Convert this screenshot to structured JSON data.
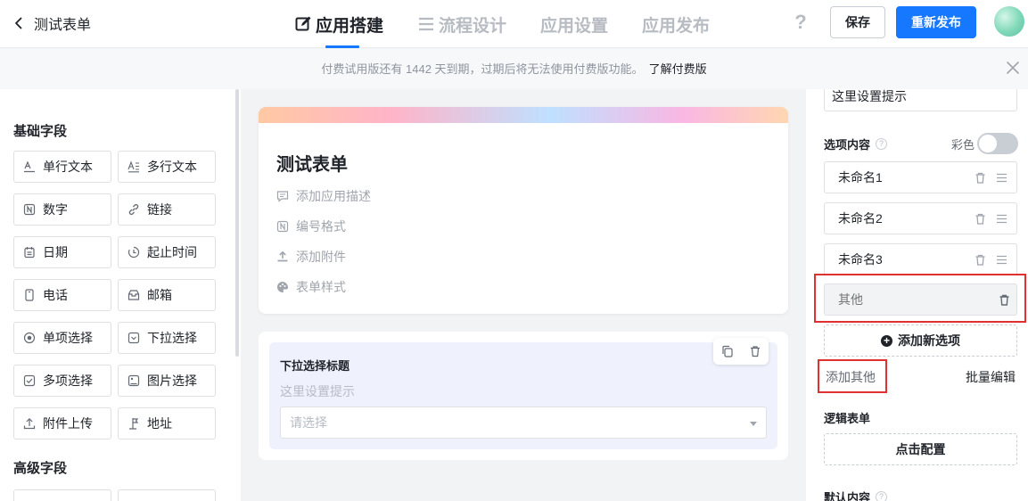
{
  "header": {
    "back_label": "测试表单",
    "tabs": [
      {
        "label": "应用搭建",
        "active": true
      },
      {
        "label": "流程设计",
        "active": false
      },
      {
        "label": "应用设置",
        "active": false
      },
      {
        "label": "应用发布",
        "active": false
      }
    ],
    "help_label": "?",
    "save_label": "保存",
    "publish_label": "重新发布",
    "accent_color": "#1677ff"
  },
  "banner": {
    "text": "付费试用版还有 1442 天到期，过期后将无法使用付费版功能。",
    "link": "了解付费版"
  },
  "left_panel": {
    "basic_title": "基础字段",
    "basic_fields": [
      {
        "label": "单行文本",
        "icon": "single-line-text-icon"
      },
      {
        "label": "多行文本",
        "icon": "multi-line-text-icon"
      },
      {
        "label": "数字",
        "icon": "number-icon"
      },
      {
        "label": "链接",
        "icon": "link-icon"
      },
      {
        "label": "日期",
        "icon": "calendar-icon"
      },
      {
        "label": "起止时间",
        "icon": "time-range-icon"
      },
      {
        "label": "电话",
        "icon": "phone-icon"
      },
      {
        "label": "邮箱",
        "icon": "mail-icon"
      },
      {
        "label": "单项选择",
        "icon": "radio-icon"
      },
      {
        "label": "下拉选择",
        "icon": "dropdown-icon"
      },
      {
        "label": "多项选择",
        "icon": "checkbox-icon"
      },
      {
        "label": "图片选择",
        "icon": "image-icon"
      },
      {
        "label": "附件上传",
        "icon": "upload-icon"
      },
      {
        "label": "地址",
        "icon": "location-icon"
      }
    ],
    "advanced_title": "高级字段"
  },
  "canvas": {
    "form_title": "测试表单",
    "meta": [
      {
        "label": "添加应用描述",
        "icon": "comment-icon"
      },
      {
        "label": "编号格式",
        "icon": "number-format-icon"
      },
      {
        "label": "添加附件",
        "icon": "upload-icon"
      },
      {
        "label": "表单样式",
        "icon": "palette-icon"
      }
    ],
    "widget": {
      "title": "下拉选择标题",
      "hint": "这里设置提示",
      "placeholder": "请选择"
    }
  },
  "right_panel": {
    "hint_value": "这里设置提示",
    "options_label": "选项内容",
    "color_label": "彩色",
    "options": [
      "未命名1",
      "未命名2",
      "未命名3"
    ],
    "other_placeholder": "其他",
    "add_option_label": "添加新选项",
    "add_other_label": "添加其他",
    "batch_edit_label": "批量编辑",
    "logic_label": "逻辑表单",
    "config_label": "点击配置",
    "default_label": "默认内容",
    "highlight_color": "#e03131"
  }
}
